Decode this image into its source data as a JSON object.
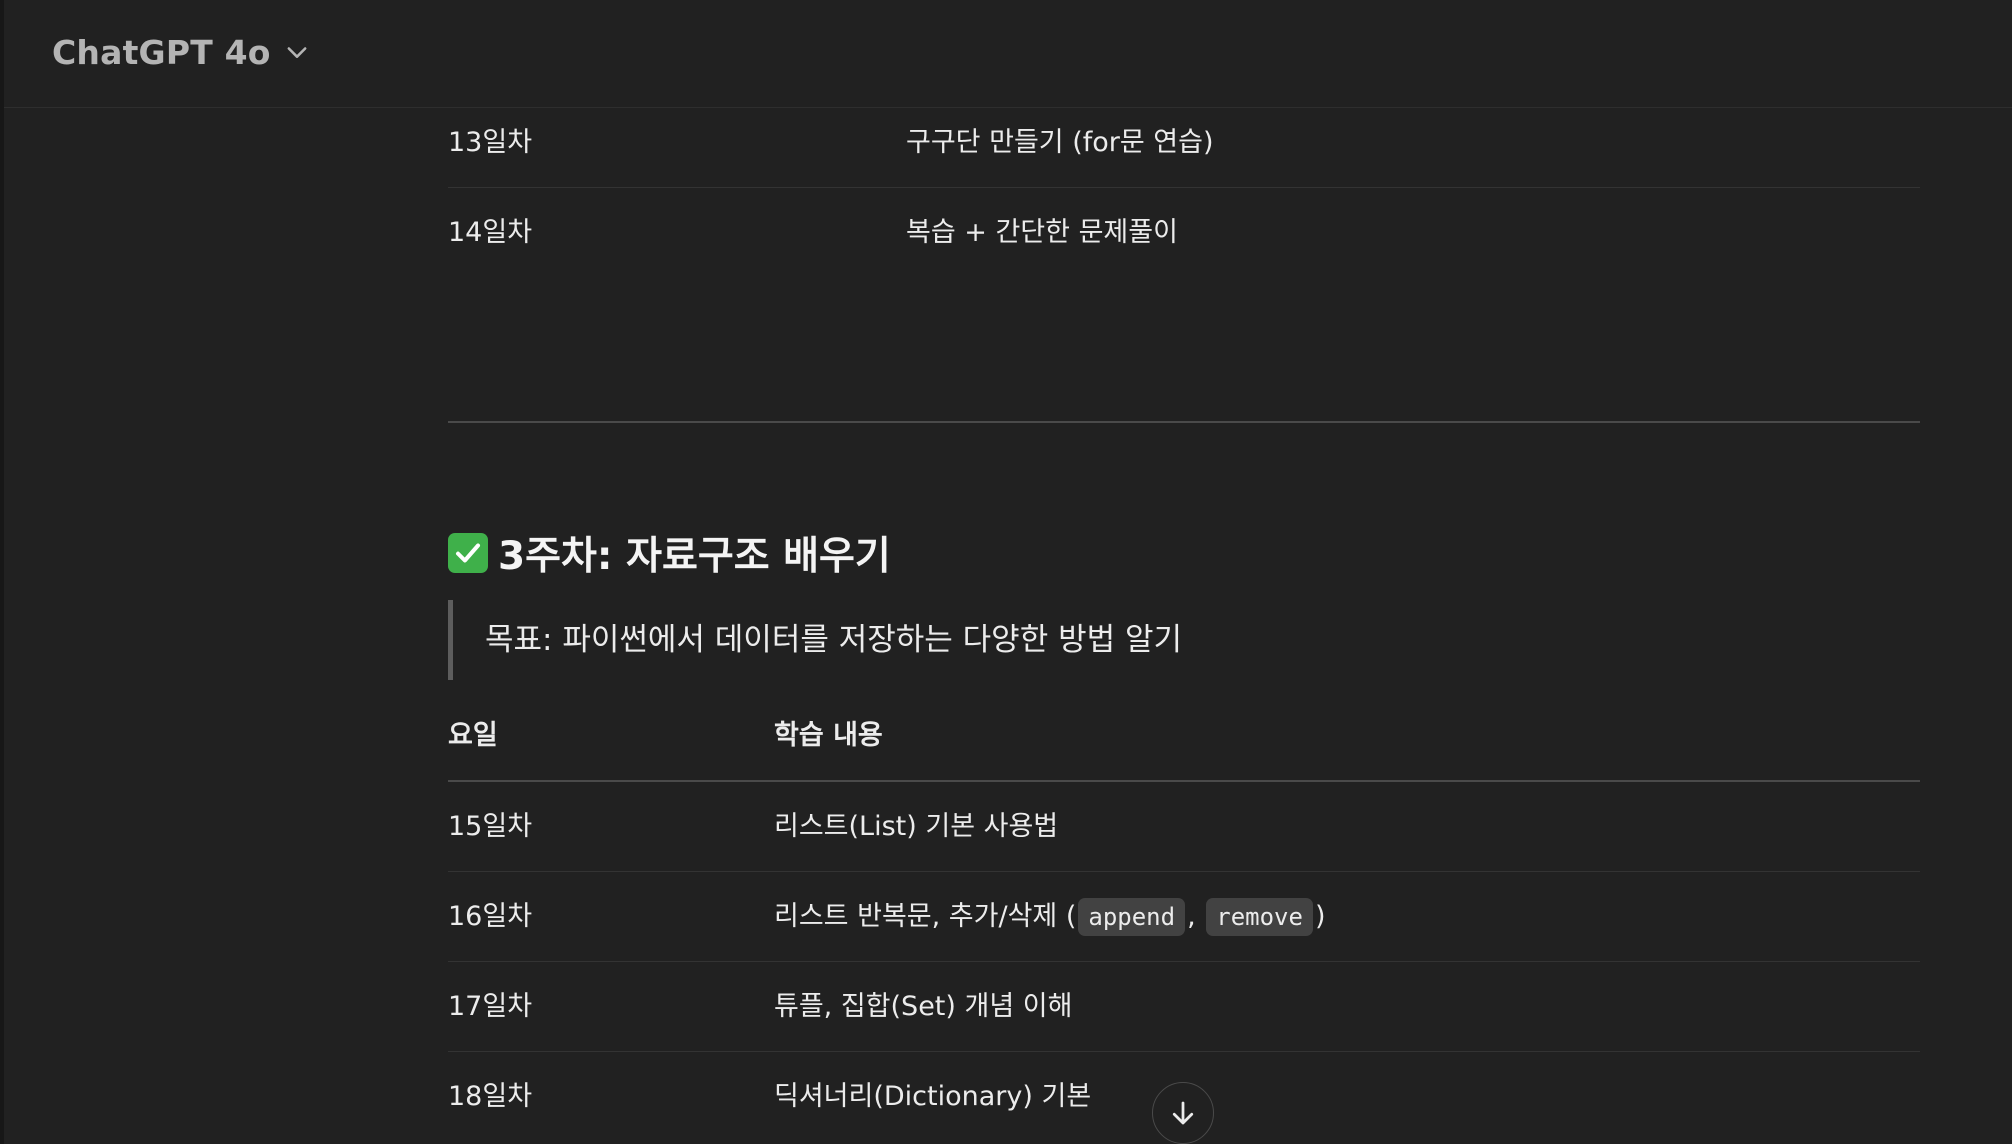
{
  "header": {
    "model_name": "ChatGPT 4o"
  },
  "week2_rows": [
    {
      "day": "13일차",
      "content": "구구단 만들기 (for문 연습)"
    },
    {
      "day": "14일차",
      "content": "복습 + 간단한 문제풀이"
    }
  ],
  "week3": {
    "title": "3주차: 자료구조 배우기",
    "goal": "목표: 파이썬에서 데이터를 저장하는 다양한 방법 알기",
    "headers": {
      "day": "요일",
      "content": "학습 내용"
    },
    "rows": [
      {
        "day": "15일차",
        "content": "리스트(List) 기본 사용법"
      },
      {
        "day": "16일차",
        "content_prefix": "리스트 반복문, 추가/삭제 (",
        "code1": "append",
        "sep": ", ",
        "code2": "remove",
        "content_suffix": ")"
      },
      {
        "day": "17일차",
        "content": "튜플, 집합(Set) 개념 이해"
      },
      {
        "day": "18일차",
        "content": "딕셔너리(Dictionary) 기본"
      }
    ]
  },
  "icons": {
    "title_icon": "check-mark-button-icon",
    "title_icon_color": "#3fb04a",
    "scroll_icon": "arrow-down-icon"
  }
}
